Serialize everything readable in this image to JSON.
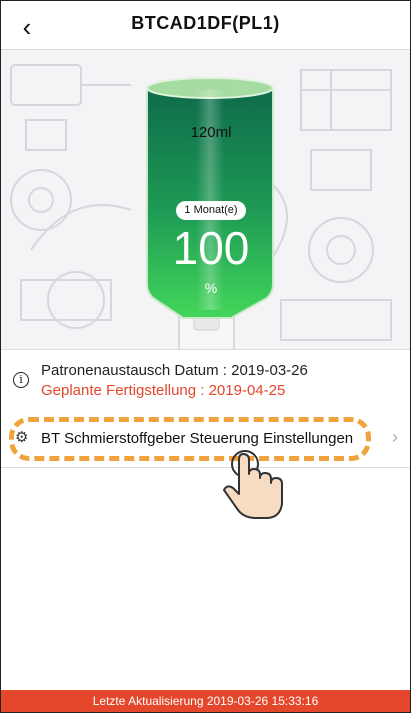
{
  "header": {
    "title": "BTCAD1DF(PL1)",
    "back_icon": "chevron-left-icon"
  },
  "cartridge": {
    "volume_label": "120ml",
    "period_badge": "1 Monat(e)",
    "level_value": "100",
    "level_unit": "%",
    "level_fraction": 1.0
  },
  "info": {
    "icon": "info-icon",
    "replacement_date_text": "Patronenaustausch Datum : 2019-03-26",
    "planned_completion_text": "Geplante Fertigstellung : 2019-04-25"
  },
  "settings_row": {
    "icon": "gears-icon",
    "label": "BT Schmierstoffgeber Steuerung Einstellungen",
    "chevron": "chevron-right-icon"
  },
  "footer": {
    "status_text": "Letzte Aktualisierung 2019-03-26 15:33:16"
  },
  "colors": {
    "accent_red": "#e4472b",
    "highlight_orange": "#f0a33c",
    "liquid_green": "#2fc45a",
    "liquid_dark": "#0e6b4a"
  }
}
